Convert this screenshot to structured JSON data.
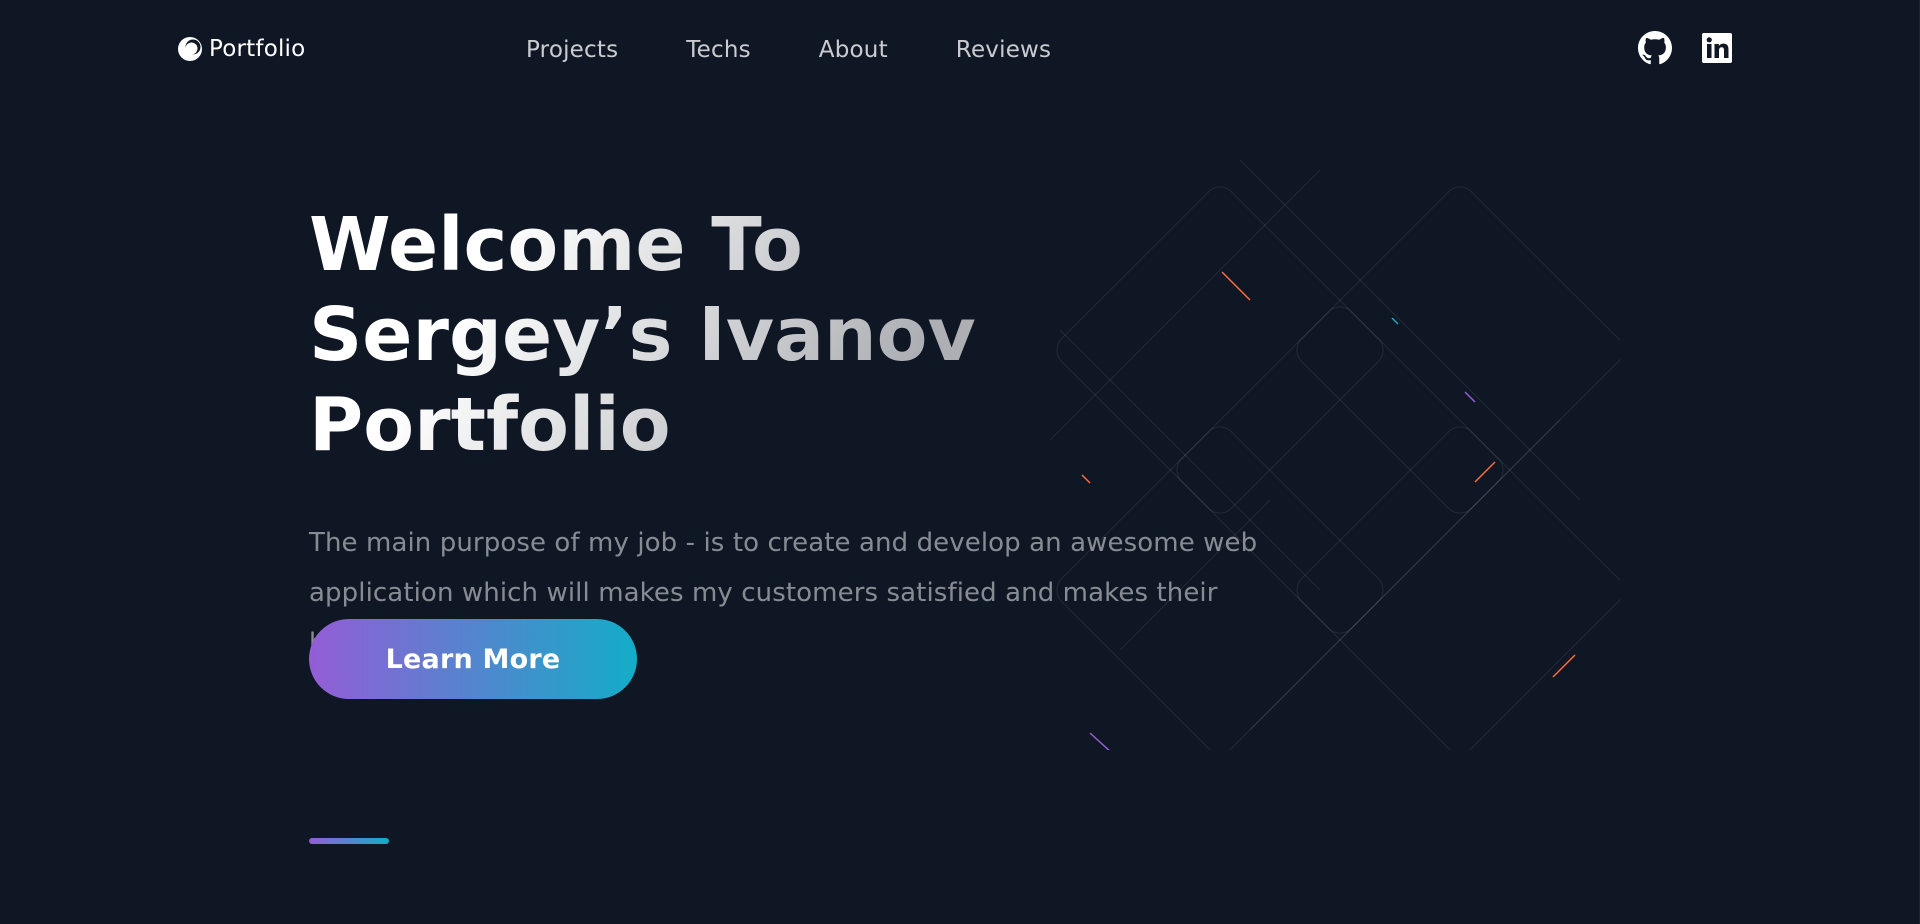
{
  "header": {
    "logo_text": "Portfolio",
    "nav": [
      {
        "label": "Projects"
      },
      {
        "label": "Techs"
      },
      {
        "label": "About"
      },
      {
        "label": "Reviews"
      }
    ],
    "social_icons": [
      "github-icon",
      "linkedin-icon"
    ]
  },
  "hero": {
    "title_line1": "Welcome To",
    "title_line2": "Sergey’s Ivanov Portfolio",
    "description": "The main purpose of my job - is to create and develop an awesome web application which will makes my customers satisfied and makes their business to grow up.",
    "button_label": "Learn More"
  },
  "colors": {
    "background": "#0f1624",
    "gradient_start": "#945DD6",
    "gradient_end": "#13ADC7"
  }
}
